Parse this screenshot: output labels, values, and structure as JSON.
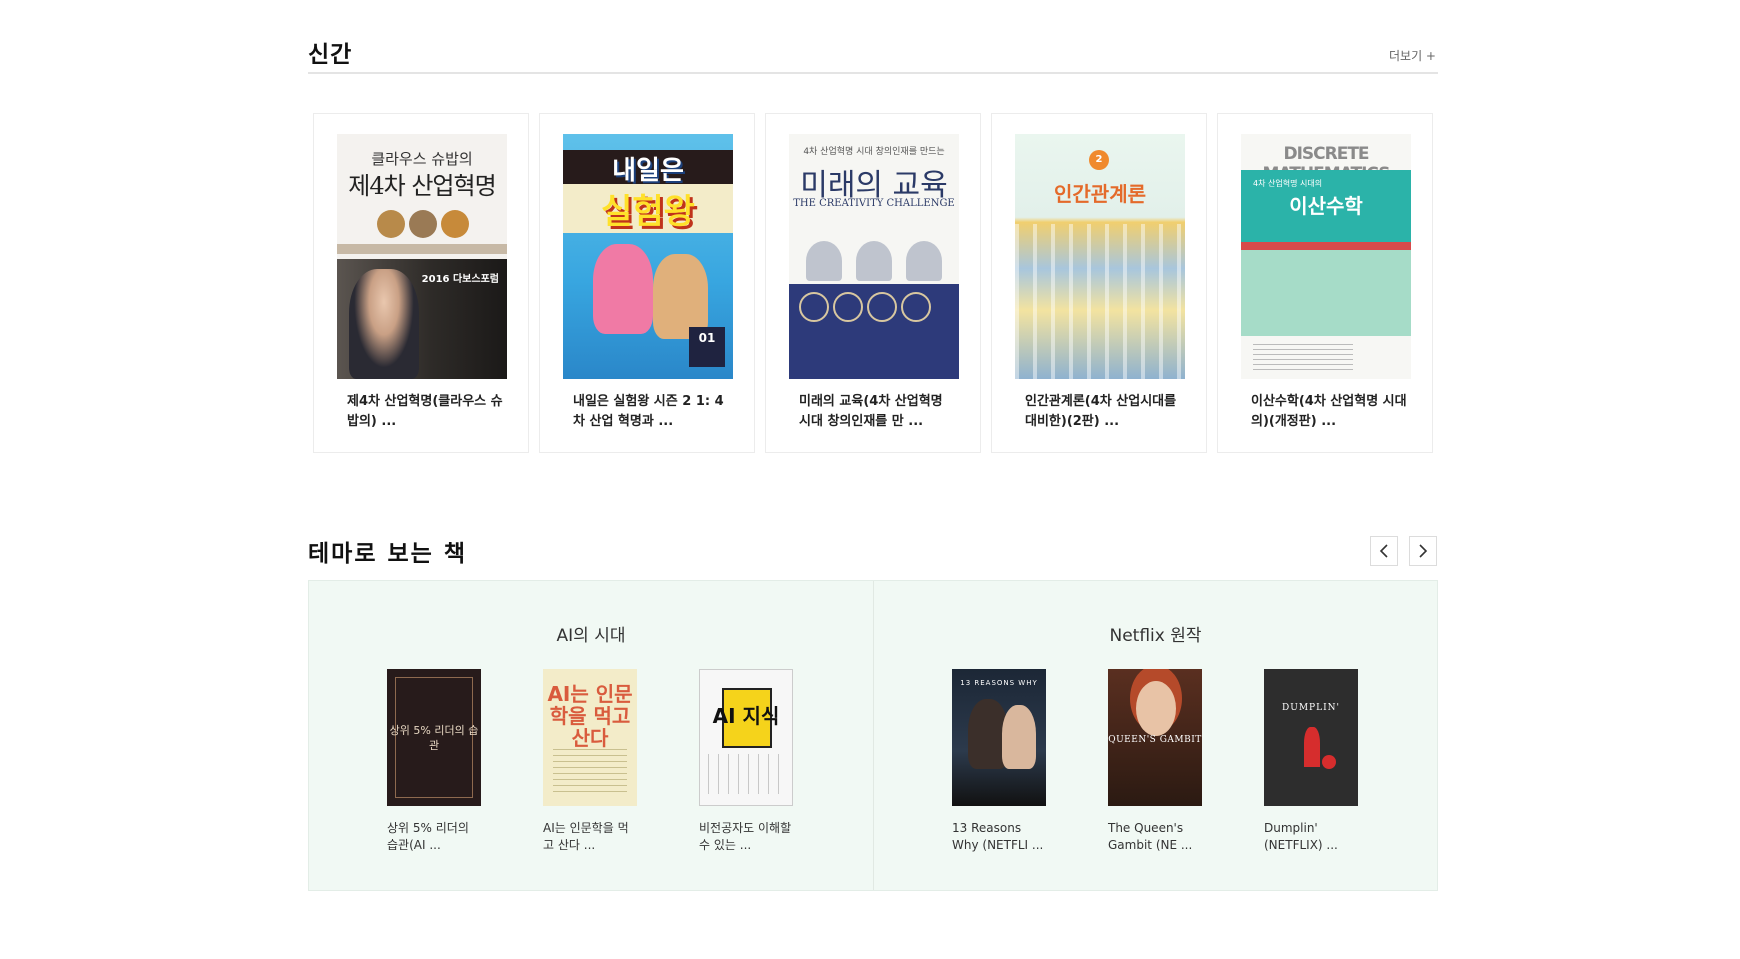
{
  "new_books": {
    "title": "신간",
    "more": "더보기 +",
    "books": [
      {
        "title": "제4차 산업혁명(클라우스 슈밥의) ...",
        "cover_pre": "클라우스 슈밥의",
        "cover_main": "제4차 산업혁명",
        "cover_note": "2016 다보스포럼"
      },
      {
        "title": "내일은 실험왕 시즌 2 1: 4차 산업 혁명과 ...",
        "cover_pre": "내일은",
        "cover_main": "실험왕",
        "cover_badge": "01"
      },
      {
        "title": "미래의 교육(4차 산업혁명 시대 창의인재를 만 ...",
        "cover_pre": "4차 산업혁명 시대 창의인재를 만드는",
        "cover_main": "미래의 교육",
        "cover_sub": "THE CREATIVITY CHALLENGE"
      },
      {
        "title": "인간관계론(4차 산업시대를 대비한)(2판) ...",
        "cover_num": "2",
        "cover_main": "인간관계론"
      },
      {
        "title": "이산수학(4차 산업혁명 시대의)(개정판) ...",
        "cover_top": "DISCRETE MATHEMATICS",
        "cover_main": "이산수학",
        "cover_pre": "4차 산업혁명 시대의"
      }
    ]
  },
  "themes": {
    "title": "테마로 보는 책",
    "prev_icon": "chevron-left-icon",
    "next_icon": "chevron-right-icon",
    "groups": [
      {
        "name": "AI의 시대",
        "books": [
          {
            "title": "상위 5% 리더의 습관(AI ...",
            "cover_text": "상위 5% 리더의 습관"
          },
          {
            "title": "AI는 인문학을 먹고 산다 ...",
            "cover_text": "AI는 인문학을 먹고 산다"
          },
          {
            "title": "비전공자도 이해할 수 있는 ...",
            "cover_text": "AI 지식"
          }
        ]
      },
      {
        "name": "Netflix 원작",
        "books": [
          {
            "title": "13 Reasons Why (NETFLI ...",
            "cover_text": "13 REASONS WHY"
          },
          {
            "title": "The Queen's Gambit (NE ...",
            "cover_text": "QUEEN'S GAMBIT"
          },
          {
            "title": "Dumplin' (NETFLIX) ...",
            "cover_text": "DUMPLIN'"
          }
        ]
      }
    ]
  }
}
